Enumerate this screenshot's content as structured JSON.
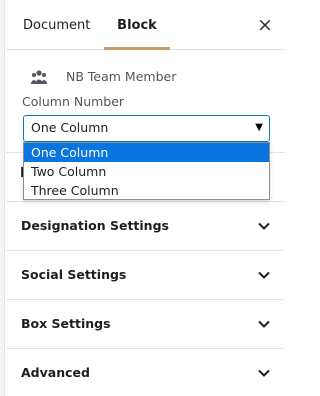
{
  "tabs": {
    "document": "Document",
    "block": "Block"
  },
  "close_icon": "×",
  "block": {
    "icon": "team-icon",
    "title": "NB Team Member"
  },
  "column_number": {
    "label": "Column Number",
    "selected": "One Column",
    "options": [
      "One Column",
      "Two Column",
      "Three Column"
    ]
  },
  "hidden_row_peek": "I",
  "sections": [
    {
      "title": "Designation Settings"
    },
    {
      "title": "Social Settings"
    },
    {
      "title": "Box Settings"
    },
    {
      "title": "Advanced"
    }
  ],
  "colors": {
    "tab_active_underline": "#c69c6d",
    "select_border": "#007cba",
    "option_highlight": "#0a74e0"
  }
}
